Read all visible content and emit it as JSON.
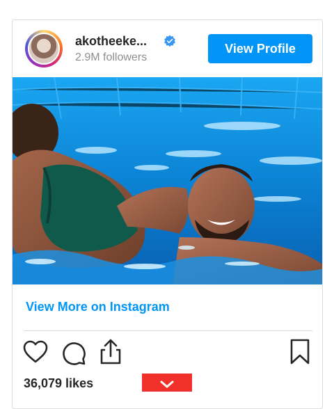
{
  "profile": {
    "username": "akotheeke...",
    "followers": "2.9M followers",
    "view_profile_label": "View Profile"
  },
  "post": {
    "view_more_label": "View More on Instagram",
    "likes": "36,079 likes"
  },
  "icons": {
    "verified": "verified-badge-icon",
    "like": "heart-icon",
    "comment": "comment-icon",
    "share": "share-icon",
    "save": "bookmark-icon",
    "scroll": "chevron-down-icon"
  },
  "colors": {
    "accent": "#0095f6",
    "red_button": "#f0312b",
    "muted_text": "#8e8e8e"
  }
}
